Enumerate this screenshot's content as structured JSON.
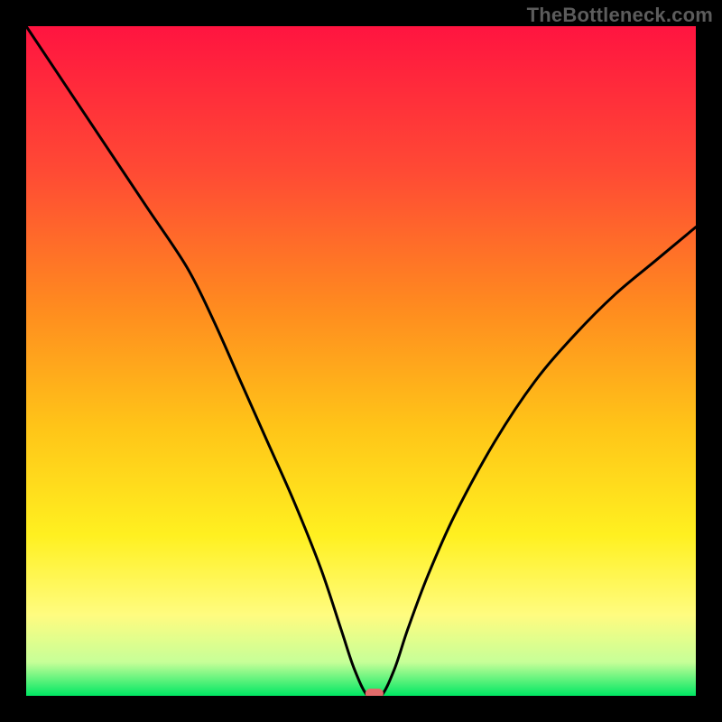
{
  "credit": "TheBottleneck.com",
  "gradient_colors": {
    "top": "#ff1440",
    "c1": "#ff4b34",
    "c2": "#ff8b1f",
    "c3": "#ffc518",
    "c4": "#fff020",
    "c5": "#fffc80",
    "c6": "#c6ff98",
    "bottom": "#00e763"
  },
  "marker_color": "#e26b6b",
  "chart_data": {
    "type": "line",
    "title": "",
    "xlabel": "",
    "ylabel": "",
    "xlim": [
      0,
      100
    ],
    "ylim": [
      0,
      100
    ],
    "series": [
      {
        "name": "curve",
        "x": [
          0,
          6,
          12,
          18,
          24,
          28,
          32,
          36,
          40,
          44,
          47,
          49,
          51,
          53,
          55,
          57,
          60,
          64,
          70,
          76,
          82,
          88,
          94,
          100
        ],
        "y": [
          100,
          91,
          82,
          73,
          64,
          56,
          47,
          38,
          29,
          19,
          10,
          4,
          0,
          0,
          4,
          10,
          18,
          27,
          38,
          47,
          54,
          60,
          65,
          70
        ]
      }
    ],
    "plateau": {
      "x_start": 49,
      "x_end": 53,
      "y": 0
    },
    "marker": {
      "x": 52,
      "y": 0
    }
  }
}
